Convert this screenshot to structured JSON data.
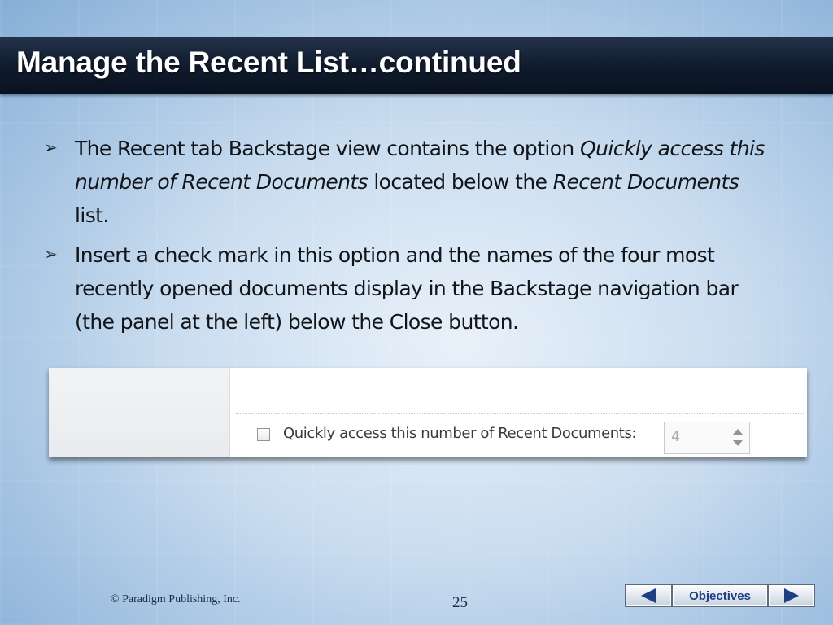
{
  "slide": {
    "title": "Manage the Recent List…continued",
    "bullets": [
      {
        "parts": [
          {
            "text": "The Recent tab Backstage view contains the option ",
            "italic": false
          },
          {
            "text": "Quickly access this number of Recent Documents",
            "italic": true
          },
          {
            "text": " located below the ",
            "italic": false
          },
          {
            "text": "Recent Documents",
            "italic": true
          },
          {
            "text": " list.",
            "italic": false
          }
        ]
      },
      {
        "parts": [
          {
            "text": "Insert a check mark in this option and the names of the four most recently opened documents display in the Backstage navigation bar (the panel at the left) below the Close button.",
            "italic": false
          }
        ]
      }
    ]
  },
  "screenshot": {
    "checkbox_label": "Quickly access this number of Recent Documents:",
    "checkbox_checked": false,
    "spinner_value": "4"
  },
  "footer": {
    "copyright": "© Paradigm Publishing, Inc.",
    "page_number": "25",
    "nav": {
      "prev_icon": "triangle-left-icon",
      "objectives_label": "Objectives",
      "next_icon": "triangle-right-icon"
    }
  },
  "colors": {
    "title_bar": "#0f1a2b",
    "title_text": "#ffffff",
    "nav_accent": "#1d3e84"
  }
}
